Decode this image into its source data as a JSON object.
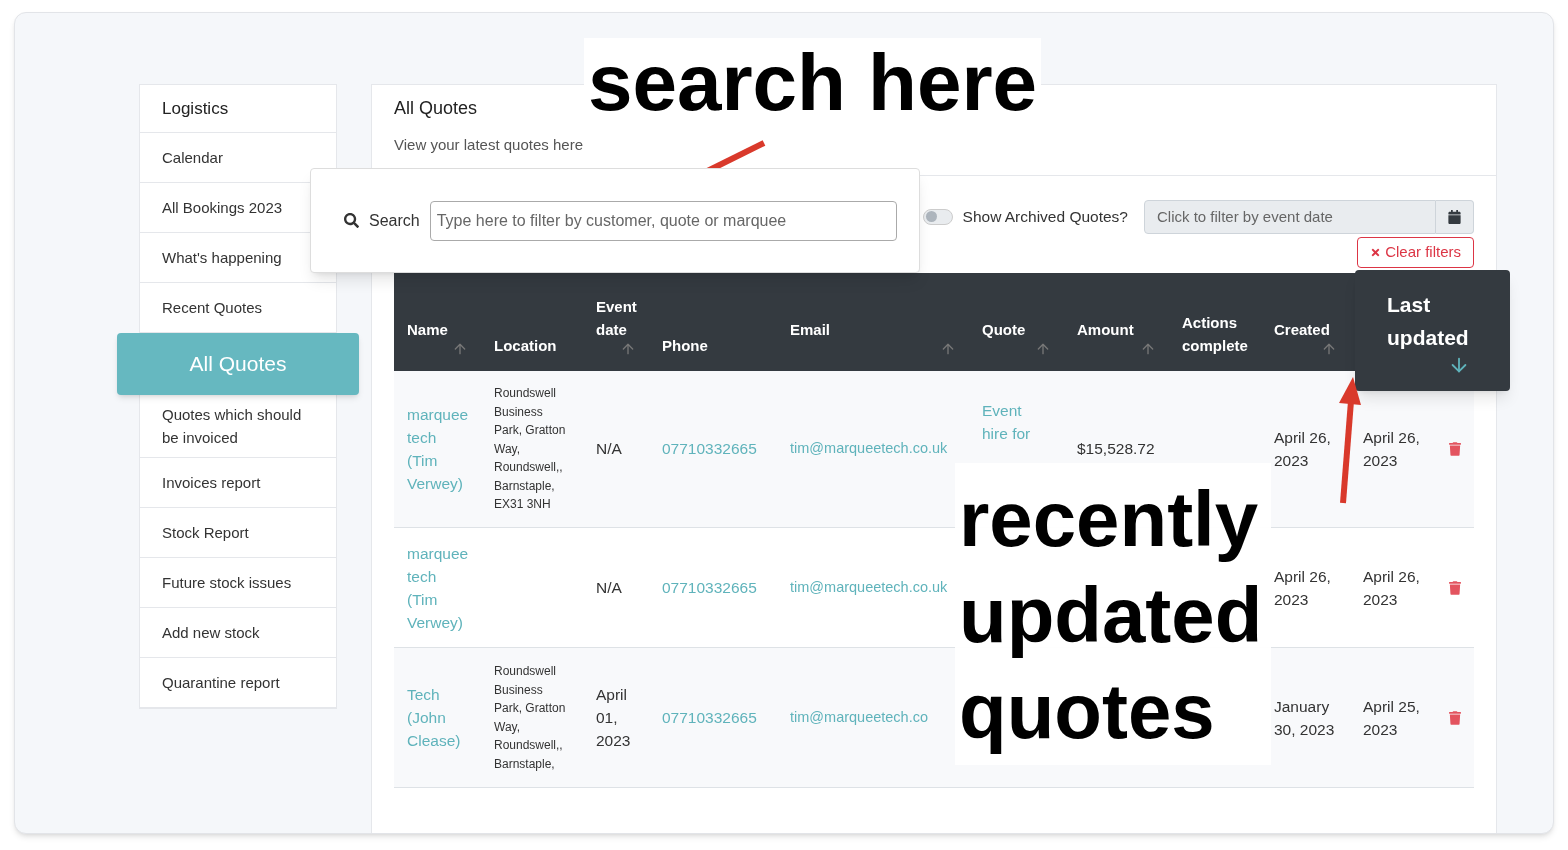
{
  "sidebar": {
    "items": [
      {
        "label": "Logistics",
        "kind": "header",
        "selected": false
      },
      {
        "label": "Calendar",
        "kind": "link",
        "selected": false
      },
      {
        "label": "All Bookings 2023",
        "kind": "link",
        "selected": false
      },
      {
        "label": "What's happening",
        "kind": "link",
        "selected": false
      },
      {
        "label": "Recent Quotes",
        "kind": "link",
        "selected": false
      },
      {
        "label": "All Quotes",
        "kind": "link",
        "selected": true
      },
      {
        "label": "Quotes which should be invoiced",
        "kind": "link",
        "selected": false
      },
      {
        "label": "Invoices report",
        "kind": "link",
        "selected": false
      },
      {
        "label": "Stock Report",
        "kind": "link",
        "selected": false
      },
      {
        "label": "Future stock issues",
        "kind": "link",
        "selected": false
      },
      {
        "label": "Add new stock",
        "kind": "link",
        "selected": false
      },
      {
        "label": "Quarantine report",
        "kind": "link",
        "selected": false
      }
    ]
  },
  "page": {
    "title": "All Quotes",
    "subtitle": "View your latest quotes here"
  },
  "search": {
    "label": "Search",
    "placeholder": "Type here to filter by customer, quote or marquee"
  },
  "archived_toggle": {
    "label": "Show Archived Quotes?",
    "on": false
  },
  "date_filter": {
    "placeholder": "Click to filter by event date"
  },
  "clear_filters": {
    "label": "Clear filters"
  },
  "table": {
    "columns": [
      {
        "label": "Name",
        "kind": "sortable",
        "sorted": false
      },
      {
        "label": "Location",
        "kind": "plain",
        "sorted": false
      },
      {
        "label": "Event date",
        "kind": "sortable",
        "sorted": false
      },
      {
        "label": "Phone",
        "kind": "plain",
        "sorted": false
      },
      {
        "label": "Email",
        "kind": "sortable",
        "sorted": false
      },
      {
        "label": "Quote",
        "kind": "sortable",
        "sorted": false
      },
      {
        "label": "Amount",
        "kind": "sortable",
        "sorted": false
      },
      {
        "label": "Actions complete",
        "kind": "plain",
        "sorted": false
      },
      {
        "label": "Created",
        "kind": "sortable",
        "sorted": false
      },
      {
        "label": "Last updated",
        "kind": "sortable",
        "sorted": true
      }
    ],
    "rows": [
      {
        "name": "marquee tech (Tim Verwey)",
        "location": "Roundswell Business Park, Gratton Way, Roundswell,, Barnstaple, EX31 3NH",
        "event_date": "N/A",
        "phone": "07710332665",
        "email": "tim@marqueetech.co.uk",
        "quote": "Event hire for",
        "amount": "$15,528.72",
        "created": "April 26, 2023",
        "last_updated": "April 26, 2023"
      },
      {
        "name": "marquee tech (Tim Verwey)",
        "event_date": "N/A",
        "phone": "07710332665",
        "email": "tim@marqueetech.co.uk",
        "created": "April 26, 2023",
        "last_updated": "April 26, 2023"
      },
      {
        "name": "Tech (John Clease)",
        "location": "Roundswell Business Park, Gratton Way, Roundswell,, Barnstaple,",
        "event_date": "April 01, 2023",
        "phone": "07710332665",
        "email": "tim@marqueetech.co",
        "created": "January 30, 2023",
        "last_updated": "April 25, 2023"
      }
    ]
  },
  "annotations": [
    {
      "text": "search here"
    },
    {
      "text": "recently updated quotes"
    }
  ]
}
